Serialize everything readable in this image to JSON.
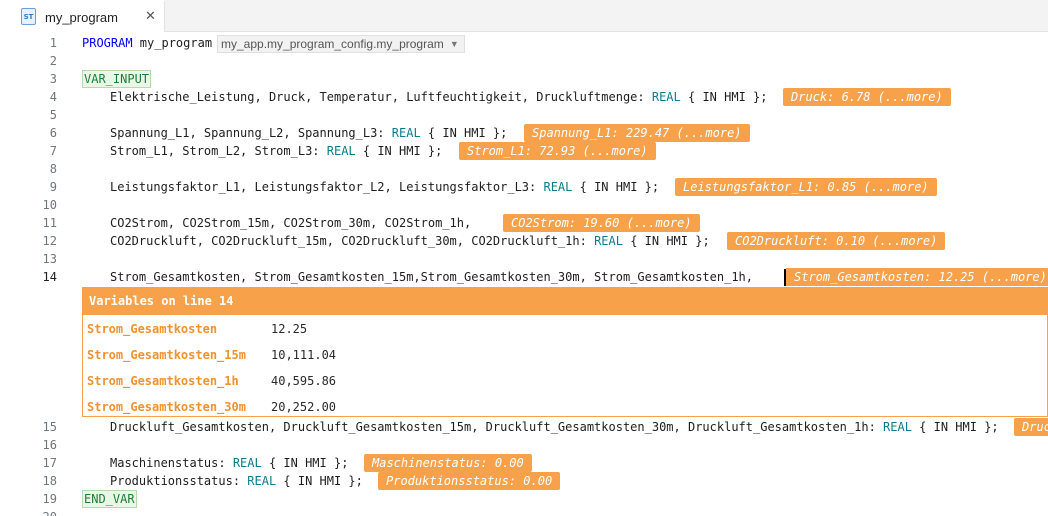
{
  "tab": {
    "title": "my_program",
    "icon_label": "ST",
    "close": "✕"
  },
  "config_select": {
    "value": "my_app.my_program_config.my_program"
  },
  "lines": [
    {
      "num": "1"
    },
    {
      "num": "2"
    },
    {
      "num": "3"
    },
    {
      "num": "4"
    },
    {
      "num": "5"
    },
    {
      "num": "6"
    },
    {
      "num": "7"
    },
    {
      "num": "8"
    },
    {
      "num": "9"
    },
    {
      "num": "10"
    },
    {
      "num": "11"
    },
    {
      "num": "12"
    },
    {
      "num": "13"
    },
    {
      "num": "14"
    },
    {
      "num": "15"
    },
    {
      "num": "16"
    },
    {
      "num": "17"
    },
    {
      "num": "18"
    },
    {
      "num": "19"
    },
    {
      "num": "20"
    }
  ],
  "code": {
    "l1_kw": "PROGRAM",
    "l1_name": " my_program",
    "l3_kw": "VAR_INPUT",
    "l4_vars": "Elektrische_Leistung, Druck, Temperatur, Luftfeuchtigkeit, Druckluftmenge: ",
    "l6_vars": "Spannung_L1, Spannung_L2, Spannung_L3: ",
    "l7_vars": "Strom_L1, Strom_L2, Strom_L3: ",
    "l9_vars": "Leistungsfaktor_L1, Leistungsfaktor_L2, Leistungsfaktor_L3: ",
    "l11_vars": "CO2Strom, CO2Strom_15m, CO2Strom_30m, CO2Strom_1h,",
    "l12_vars": "CO2Druckluft, CO2Druckluft_15m, CO2Druckluft_30m, CO2Druckluft_1h: ",
    "l14_vars": "Strom_Gesamtkosten, Strom_Gesamtkosten_15m,Strom_Gesamtkosten_30m, Strom_Gesamtkosten_1h,",
    "l15_vars": "Druckluft_Gesamtkosten, Druckluft_Gesamtkosten_15m, Druckluft_Gesamtkosten_30m, Druckluft_Gesamtkosten_1h: ",
    "l17_vars": "Maschinenstatus: ",
    "l18_vars": "Produktionsstatus: ",
    "l19_kw": "END_VAR",
    "type_real": "REAL",
    "attr": " { IN HMI };"
  },
  "hints": {
    "l4": "Druck: 6.78 (...more)",
    "l6": "Spannung_L1: 229.47 (...more)",
    "l7": "Strom_L1: 72.93 (...more)",
    "l9": "Leistungsfaktor_L1: 0.85 (...more)",
    "l11": "CO2Strom: 19.60 (...more)",
    "l12": "CO2Druckluft: 0.10 (...more)",
    "l14": "Strom_Gesamtkosten: 12.25 (...more)",
    "l15": "Druc",
    "l17": "Maschinenstatus: 0.00",
    "l18": "Produktionsstatus: 0.00"
  },
  "panel": {
    "title": "Variables on line 14",
    "variables": [
      {
        "name": "Strom_Gesamtkosten",
        "value": "12.25"
      },
      {
        "name": "Strom_Gesamtkosten_15m",
        "value": "10,111.04"
      },
      {
        "name": "Strom_Gesamtkosten_1h",
        "value": "40,595.86"
      },
      {
        "name": "Strom_Gesamtkosten_30m",
        "value": "20,252.00"
      }
    ]
  },
  "colors": {
    "accent": "#f7a24b",
    "keyword": "#0000ff",
    "type": "#0e7d8a"
  }
}
